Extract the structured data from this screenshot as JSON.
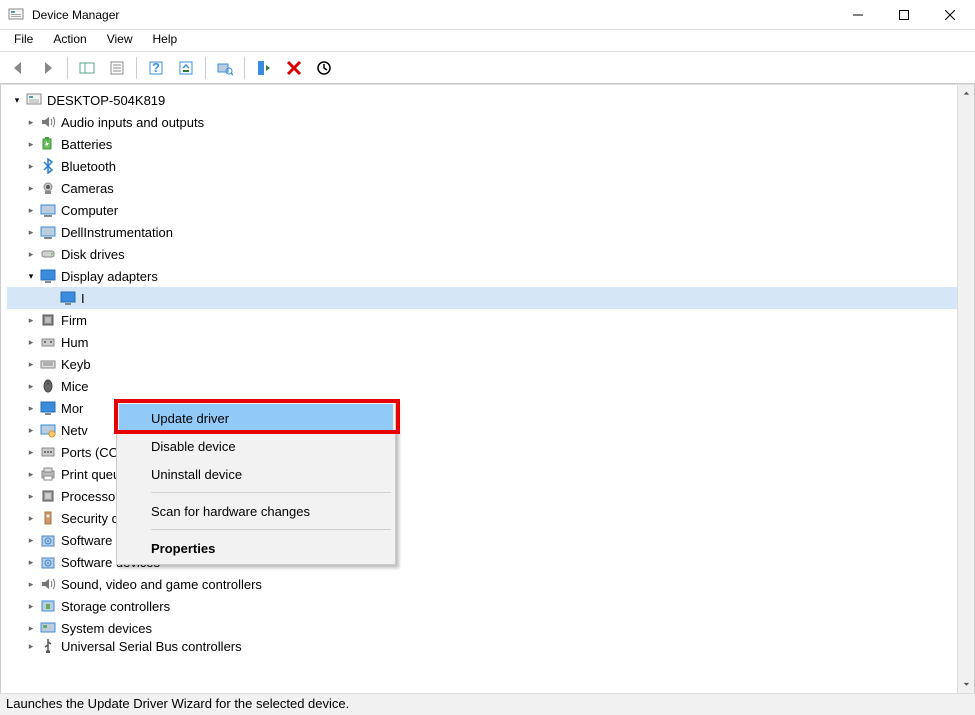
{
  "title": "Device Manager",
  "menus": [
    "File",
    "Action",
    "View",
    "Help"
  ],
  "root": "DESKTOP-504K819",
  "categories": [
    {
      "label": "Audio inputs and outputs",
      "icon": "audio"
    },
    {
      "label": "Batteries",
      "icon": "battery"
    },
    {
      "label": "Bluetooth",
      "icon": "bluetooth"
    },
    {
      "label": "Cameras",
      "icon": "camera"
    },
    {
      "label": "Computer",
      "icon": "computer"
    },
    {
      "label": "DellInstrumentation",
      "icon": "computer"
    },
    {
      "label": "Disk drives",
      "icon": "disk"
    },
    {
      "label": "Display adapters",
      "icon": "monitor",
      "expanded": true,
      "children": [
        {
          "label": "I",
          "icon": "monitor",
          "selected": true
        }
      ]
    },
    {
      "label": "Firm",
      "icon": "chip",
      "truncated": true
    },
    {
      "label": "Hum",
      "icon": "hid",
      "truncated": true
    },
    {
      "label": "Keyb",
      "icon": "keyboard",
      "truncated": true
    },
    {
      "label": "Mice",
      "icon": "mouse",
      "truncated": true
    },
    {
      "label": "Mor",
      "icon": "monitor",
      "truncated": true
    },
    {
      "label": "Netv",
      "icon": "network",
      "truncated": true
    },
    {
      "label": "Ports (COM & LPT)",
      "icon": "port"
    },
    {
      "label": "Print queues",
      "icon": "printer"
    },
    {
      "label": "Processors",
      "icon": "cpu"
    },
    {
      "label": "Security devices",
      "icon": "security"
    },
    {
      "label": "Software components",
      "icon": "software"
    },
    {
      "label": "Software devices",
      "icon": "software"
    },
    {
      "label": "Sound, video and game controllers",
      "icon": "audio"
    },
    {
      "label": "Storage controllers",
      "icon": "storage"
    },
    {
      "label": "System devices",
      "icon": "system"
    },
    {
      "label": "Universal Serial Bus controllers",
      "icon": "usb",
      "cut": true
    }
  ],
  "context_menu": {
    "items": [
      {
        "label": "Update driver",
        "highlight": true
      },
      {
        "label": "Disable device"
      },
      {
        "label": "Uninstall device"
      },
      {
        "sep": true
      },
      {
        "label": "Scan for hardware changes"
      },
      {
        "sep": true
      },
      {
        "label": "Properties",
        "bold": true
      }
    ]
  },
  "statusbar": "Launches the Update Driver Wizard for the selected device.",
  "icons": {
    "audio": "🔊",
    "battery": "🔋",
    "bluetooth": "bt",
    "camera": "📷",
    "computer": "🖥",
    "disk": "💽",
    "monitor": "🖥",
    "chip": "▤",
    "hid": "🕹",
    "keyboard": "⌨",
    "mouse": "🖱",
    "network": "🖧",
    "port": "🔌",
    "printer": "🖨",
    "cpu": "▦",
    "security": "🔒",
    "software": "📦",
    "storage": "💾",
    "system": "⚙",
    "usb": "⎙"
  }
}
